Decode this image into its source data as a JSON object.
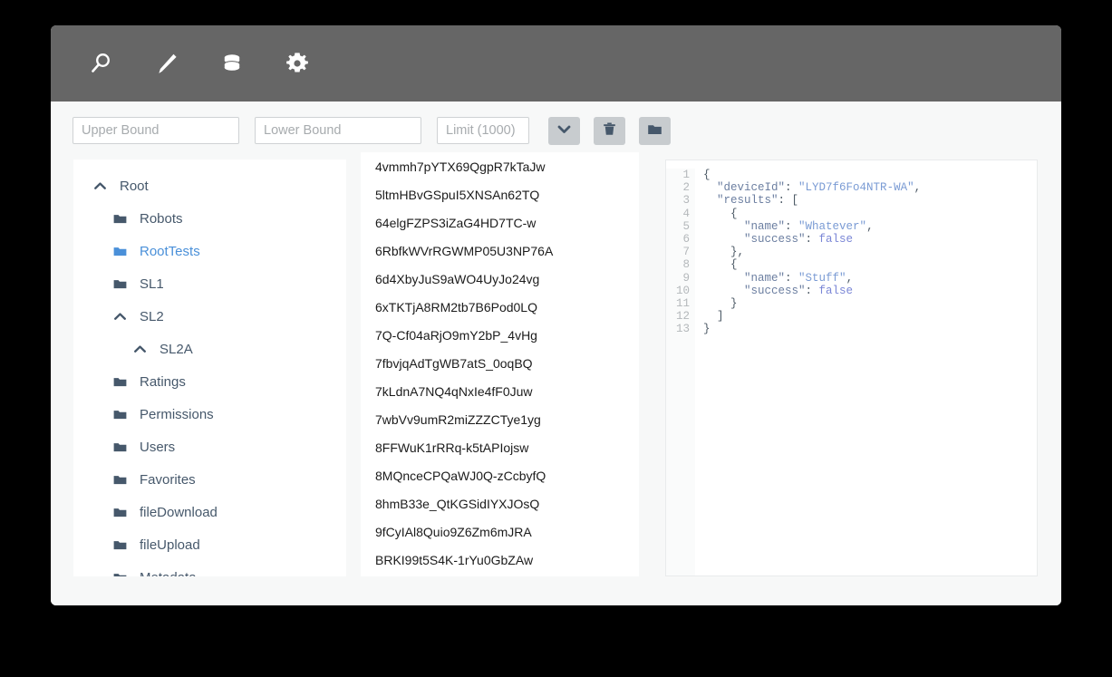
{
  "toolbar": {
    "items": [
      {
        "name": "search-icon",
        "label": "Search"
      },
      {
        "name": "edit-icon",
        "label": "Edit"
      },
      {
        "name": "database-icon",
        "label": "Database"
      },
      {
        "name": "gear-icon",
        "label": "Settings"
      }
    ]
  },
  "filter_bar": {
    "upper_bound": {
      "value": "",
      "placeholder": "Upper Bound"
    },
    "lower_bound": {
      "value": "",
      "placeholder": "Lower Bound"
    },
    "limit": {
      "value": "",
      "placeholder": "Limit (1000)"
    },
    "buttons": [
      {
        "name": "chevron-down-icon",
        "label": "Expand"
      },
      {
        "name": "trash-icon",
        "label": "Delete"
      },
      {
        "name": "folder-icon",
        "label": "New Folder"
      }
    ]
  },
  "tree": {
    "items": [
      {
        "label": "Root",
        "depth": 0,
        "icon": "chevron-up-icon",
        "selected": false
      },
      {
        "label": "Robots",
        "depth": 1,
        "icon": "folder-icon",
        "selected": false
      },
      {
        "label": "RootTests",
        "depth": 1,
        "icon": "folder-icon",
        "selected": true
      },
      {
        "label": "SL1",
        "depth": 1,
        "icon": "folder-icon",
        "selected": false
      },
      {
        "label": "SL2",
        "depth": 1,
        "icon": "chevron-up-icon",
        "selected": false
      },
      {
        "label": "SL2A",
        "depth": 2,
        "icon": "chevron-up-icon",
        "selected": false
      },
      {
        "label": "Ratings",
        "depth": 1,
        "icon": "folder-icon",
        "selected": false
      },
      {
        "label": "Permissions",
        "depth": 1,
        "icon": "folder-icon",
        "selected": false
      },
      {
        "label": "Users",
        "depth": 1,
        "icon": "folder-icon",
        "selected": false
      },
      {
        "label": "Favorites",
        "depth": 1,
        "icon": "folder-icon",
        "selected": false
      },
      {
        "label": "fileDownload",
        "depth": 1,
        "icon": "folder-icon",
        "selected": false
      },
      {
        "label": "fileUpload",
        "depth": 1,
        "icon": "folder-icon",
        "selected": false
      },
      {
        "label": "Metadata",
        "depth": 1,
        "icon": "folder-icon",
        "selected": false
      }
    ]
  },
  "list": {
    "items": [
      "4vmmh7pYTX69QgpR7kTaJw",
      "5ltmHBvGSpuI5XNSAn62TQ",
      "64elgFZPS3iZaG4HD7TC-w",
      "6RbfkWVrRGWMP05U3NP76A",
      "6d4XbyJuS9aWO4UyJo24vg",
      "6xTKTjA8RM2tb7B6Pod0LQ",
      "7Q-Cf04aRjO9mY2bP_4vHg",
      "7fbvjqAdTgWB7atS_0oqBQ",
      "7kLdnA7NQ4qNxIe4fF0Juw",
      "7wbVv9umR2miZZZCTye1yg",
      "8FFWuK1rRRq-k5tAPIojsw",
      "8MQnceCPQaWJ0Q-zCcbyfQ",
      "8hmB33e_QtKGSidIYXJOsQ",
      "9fCyIAl8Quio9Z6Zm6mJRA",
      "BRKI99t5S4K-1rYu0GbZAw"
    ]
  },
  "code": {
    "line_numbers": [
      "1",
      "2",
      "3",
      "4",
      "5",
      "6",
      "7",
      "8",
      "9",
      "10",
      "11",
      "12",
      "13"
    ],
    "lines": [
      [
        {
          "t": "{",
          "c": "punc"
        }
      ],
      [
        {
          "t": "  ",
          "c": "punc"
        },
        {
          "t": "\"deviceId\"",
          "c": "key"
        },
        {
          "t": ": ",
          "c": "punc"
        },
        {
          "t": "\"LYD7f6Fo4NTR-WA\"",
          "c": "str"
        },
        {
          "t": ",",
          "c": "punc"
        }
      ],
      [
        {
          "t": "  ",
          "c": "punc"
        },
        {
          "t": "\"results\"",
          "c": "key"
        },
        {
          "t": ": [",
          "c": "punc"
        }
      ],
      [
        {
          "t": "    {",
          "c": "punc"
        }
      ],
      [
        {
          "t": "      ",
          "c": "punc"
        },
        {
          "t": "\"name\"",
          "c": "key"
        },
        {
          "t": ": ",
          "c": "punc"
        },
        {
          "t": "\"Whatever\"",
          "c": "str"
        },
        {
          "t": ",",
          "c": "punc"
        }
      ],
      [
        {
          "t": "      ",
          "c": "punc"
        },
        {
          "t": "\"success\"",
          "c": "key"
        },
        {
          "t": ": ",
          "c": "punc"
        },
        {
          "t": "false",
          "c": "bool"
        }
      ],
      [
        {
          "t": "    },",
          "c": "punc"
        }
      ],
      [
        {
          "t": "    {",
          "c": "punc"
        }
      ],
      [
        {
          "t": "      ",
          "c": "punc"
        },
        {
          "t": "\"name\"",
          "c": "key"
        },
        {
          "t": ": ",
          "c": "punc"
        },
        {
          "t": "\"Stuff\"",
          "c": "str"
        },
        {
          "t": ",",
          "c": "punc"
        }
      ],
      [
        {
          "t": "      ",
          "c": "punc"
        },
        {
          "t": "\"success\"",
          "c": "key"
        },
        {
          "t": ": ",
          "c": "punc"
        },
        {
          "t": "false",
          "c": "bool"
        }
      ],
      [
        {
          "t": "    }",
          "c": "punc"
        }
      ],
      [
        {
          "t": "  ]",
          "c": "punc"
        }
      ],
      [
        {
          "t": "}",
          "c": "punc"
        }
      ]
    ]
  },
  "colors": {
    "toolbar_bg": "#666666",
    "window_bg": "#f7f8f8",
    "panel_bg": "#ffffff",
    "tree_text": "#46586b",
    "tree_selected": "#4a90d9",
    "icon_slate": "#46586b",
    "button_bg": "#c8cccf"
  }
}
